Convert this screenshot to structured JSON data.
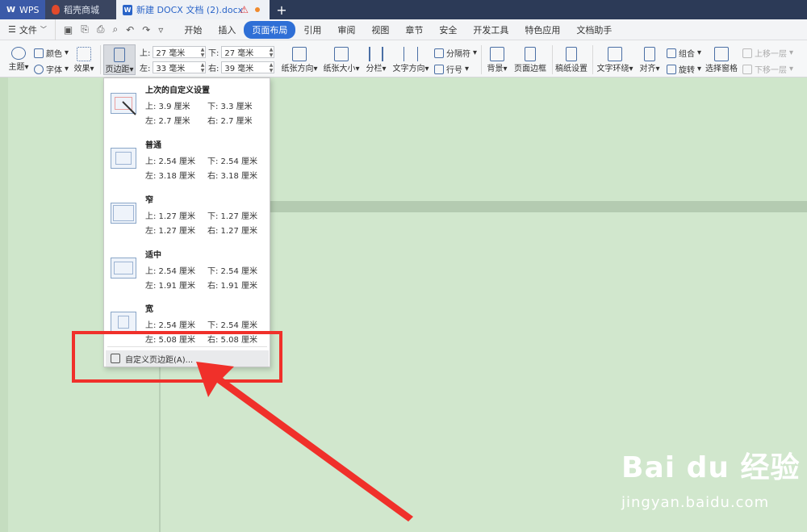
{
  "titlebar": {
    "tabs": [
      {
        "label": "WPS"
      },
      {
        "label": "稻壳商城"
      },
      {
        "label": "新建 DOCX 文档 (2).docx"
      }
    ],
    "warn_icon": "⚠",
    "add_label": "+"
  },
  "menubar": {
    "file_label": "文件",
    "items": [
      "开始",
      "插入",
      "页面布局",
      "引用",
      "审阅",
      "视图",
      "章节",
      "安全",
      "开发工具",
      "特色应用",
      "文档助手"
    ],
    "active": "页面布局"
  },
  "ribbon": {
    "theme": "主题",
    "color": "颜色",
    "font": "字体",
    "effect": "效果",
    "margins": "页边距",
    "top_label": "上:",
    "top_value": "27 毫米",
    "bottom_label": "下:",
    "bottom_value": "27 毫米",
    "left_label": "左:",
    "left_value": "33 毫米",
    "right_label": "右:",
    "right_value": "39 毫米",
    "orientation": "纸张方向",
    "size": "纸张大小",
    "columns": "分栏",
    "text_direction": "文字方向",
    "breaks": "分隔符",
    "line_numbers": "行号",
    "background": "背景",
    "page_border": "页面边框",
    "draft_settings": "稿纸设置",
    "wrap_text": "文字环绕",
    "align": "对齐",
    "group": "组合",
    "rotate": "旋转",
    "selection_pane": "选择窗格",
    "bring_forward": "上移一层",
    "send_backward": "下移一层"
  },
  "dropdown": {
    "presets": [
      {
        "name": "上次的自定义设置",
        "top": "上: 3.9 厘米",
        "bottom": "下: 3.3 厘米",
        "left": "左: 2.7 厘米",
        "right": "右: 2.7 厘米"
      },
      {
        "name": "普通",
        "top": "上: 2.54 厘米",
        "bottom": "下: 2.54 厘米",
        "left": "左: 3.18 厘米",
        "right": "右: 3.18 厘米"
      },
      {
        "name": "窄",
        "top": "上: 1.27 厘米",
        "bottom": "下: 1.27 厘米",
        "left": "左: 1.27 厘米",
        "right": "右: 1.27 厘米"
      },
      {
        "name": "适中",
        "top": "上: 2.54 厘米",
        "bottom": "下: 2.54 厘米",
        "left": "左: 1.91 厘米",
        "right": "右: 1.91 厘米"
      },
      {
        "name": "宽",
        "top": "上: 2.54 厘米",
        "bottom": "下: 2.54 厘米",
        "left": "左: 5.08 厘米",
        "right": "右: 5.08 厘米"
      }
    ],
    "custom_label": "自定义页边距(A)..."
  },
  "watermark": {
    "logo": "Bai du 经验",
    "url": "jingyan.baidu.com"
  },
  "colors": {
    "accent": "#2f6fd6",
    "annotation": "#f0302a",
    "canvas": "#cfe6cb"
  }
}
